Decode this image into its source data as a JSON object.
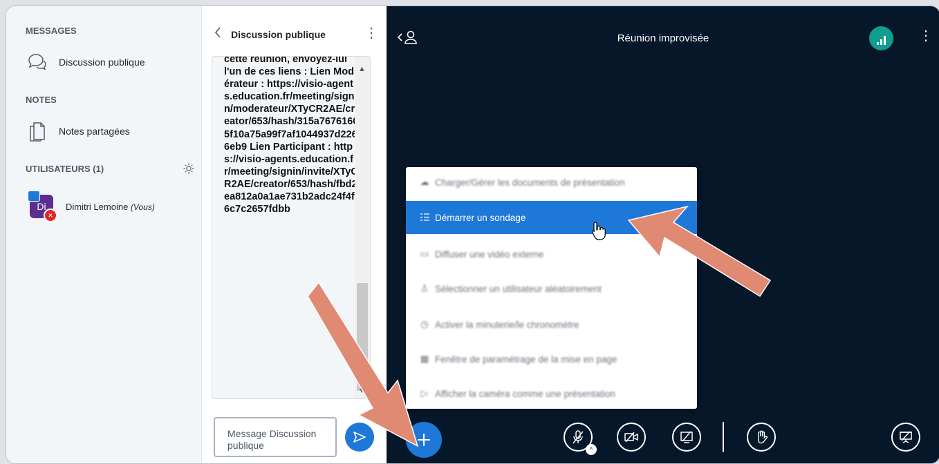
{
  "sidebar": {
    "messages_heading": "MESSAGES",
    "public_chat_label": "Discussion publique",
    "notes_heading": "NOTES",
    "shared_notes_label": "Notes partagées",
    "users_heading": "UTILISATEURS (1)",
    "user": {
      "initials": "Di",
      "name": "Dimitri Lemoine",
      "you_tag": "(Vous)"
    }
  },
  "chat": {
    "title": "Discussion publique",
    "message_text": "cette réunion, envoyez-lui l'un de ces liens : Lien Modérateur : https://visio-agents.education.fr/meeting/signin/moderateur/XTyCR2AE/creator/653/hash/315a76761605f10a75a99f7af1044937d2266eb9 Lien Participant : https://visio-agents.education.fr/meeting/signin/invite/XTyCR2AE/creator/653/hash/fbd2ea812a0a1ae731b2adc24f4f6c7c2657fdbb",
    "input_placeholder": "Message Discussion publique"
  },
  "meeting": {
    "title": "Réunion improvisée",
    "menu": [
      {
        "icon": "upload-icon",
        "label": "Charger/Gérer les documents de présentation",
        "state": "blurred"
      },
      {
        "icon": "poll-icon",
        "label": "Démarrer un sondage",
        "state": "active"
      },
      {
        "icon": "external-video-icon",
        "label": "Diffuser une vidéo externe",
        "state": "blurred"
      },
      {
        "icon": "random-user-icon",
        "label": "Sélectionner un utilisateur aléatoirement",
        "state": "blurred"
      },
      {
        "icon": "timer-icon",
        "label": "Activer la minuterie/le chronomètre",
        "state": "blurred"
      },
      {
        "icon": "layout-icon",
        "label": "Fenêtre de paramétrage de la mise en page",
        "state": "blurred"
      },
      {
        "icon": "camera-icon",
        "label": "Afficher la caméra comme une présentation",
        "state": "blurred"
      }
    ]
  },
  "colors": {
    "accent": "#1e78d7",
    "meeting_bg": "#06172a",
    "annotation_arrow": "#e08a74",
    "connection": "#0f9e8f"
  }
}
